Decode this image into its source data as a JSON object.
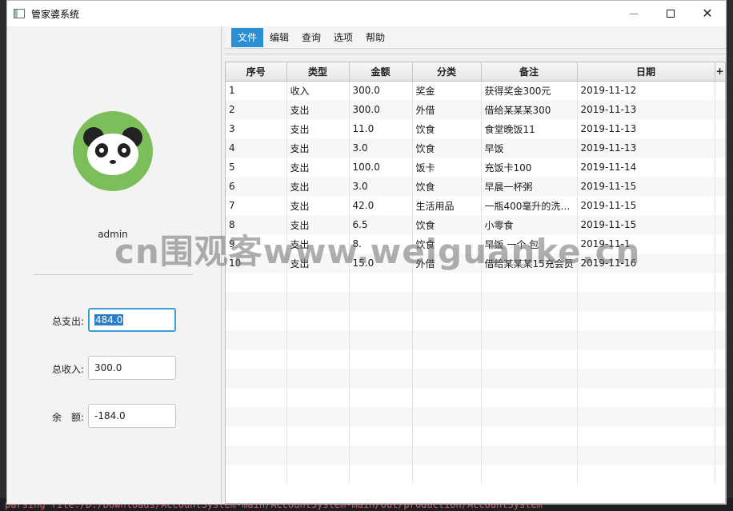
{
  "window": {
    "title": "管家婆系统"
  },
  "user": {
    "name": "admin"
  },
  "stats": {
    "expense_label": "总支出:",
    "expense_value": "484.0",
    "income_label": "总收入:",
    "income_value": "300.0",
    "balance_label": "余　额:",
    "balance_value": "-184.0"
  },
  "menu": [
    "文件",
    "编辑",
    "查询",
    "选项",
    "帮助"
  ],
  "table": {
    "columns": [
      "序号",
      "类型",
      "金额",
      "分类",
      "备注",
      "日期"
    ],
    "plus": "+",
    "rows": [
      [
        "1",
        "收入",
        "300.0",
        "奖金",
        "获得奖金300元",
        "2019-11-12"
      ],
      [
        "2",
        "支出",
        "300.0",
        "外借",
        "借给某某某300",
        "2019-11-13"
      ],
      [
        "3",
        "支出",
        "11.0",
        "饮食",
        "食堂晚饭11",
        "2019-11-13"
      ],
      [
        "4",
        "支出",
        "3.0",
        "饮食",
        "早饭",
        "2019-11-13"
      ],
      [
        "5",
        "支出",
        "100.0",
        "饭卡",
        "充饭卡100",
        "2019-11-14"
      ],
      [
        "6",
        "支出",
        "3.0",
        "饮食",
        "早晨一杯粥",
        "2019-11-15"
      ],
      [
        "7",
        "支出",
        "42.0",
        "生活用品",
        "一瓶400毫升的洗…",
        "2019-11-15"
      ],
      [
        "8",
        "支出",
        "6.5",
        "饮食",
        "小零食",
        "2019-11-15"
      ],
      [
        "9",
        "支出",
        "8.",
        "饮食",
        "早饭 一个 包",
        "2019-11-1"
      ],
      [
        "10",
        "支出",
        "15.0",
        "外借",
        "借给某某某15充会员",
        "2019-11-16"
      ]
    ]
  },
  "watermark": "cn围观客www.weiguanke.cn",
  "console": "parsing file:/D:/Downloads/AccountSystem-main/AccountSystem-main/out/production/AccountSystem"
}
